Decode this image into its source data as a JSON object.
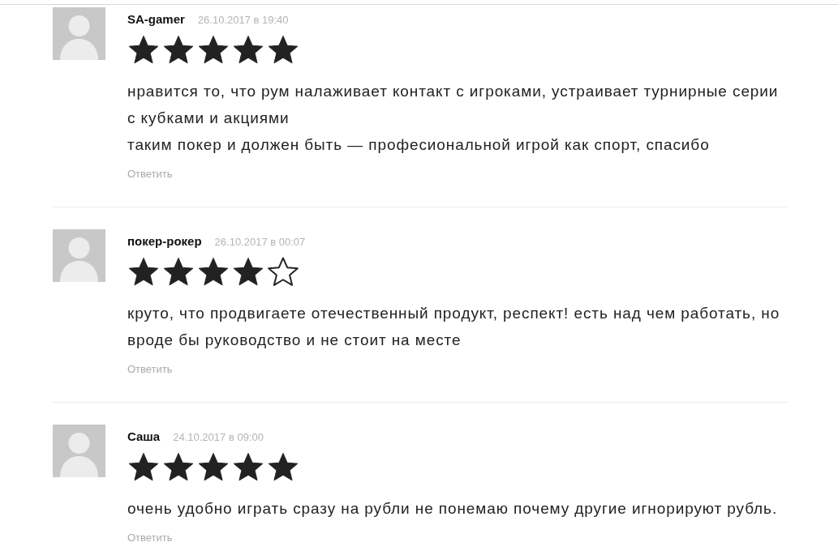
{
  "comments": [
    {
      "author": "SA-gamer",
      "date": "26.10.2017 в 19:40",
      "stars": 5,
      "paragraphs": [
        "нравится то, что рум налаживает контакт с игроками, устраивает турнирные серии с кубками и акциями",
        "таким покер и должен быть — професиональной игрой как спорт, спасибо"
      ],
      "reply": "Ответить"
    },
    {
      "author": "покер-рокер",
      "date": "26.10.2017 в 00:07",
      "stars": 4,
      "paragraphs": [
        "круто, что продвигаете отечественный продукт, респект! есть над чем работать, но вроде бы руководство и не стоит на месте"
      ],
      "reply": "Ответить"
    },
    {
      "author": "Саша",
      "date": "24.10.2017 в 09:00",
      "stars": 5,
      "paragraphs": [
        "очень удобно играть сразу на рубли не понемаю почему другие игнорируют рубль."
      ],
      "reply": "Ответить"
    }
  ]
}
